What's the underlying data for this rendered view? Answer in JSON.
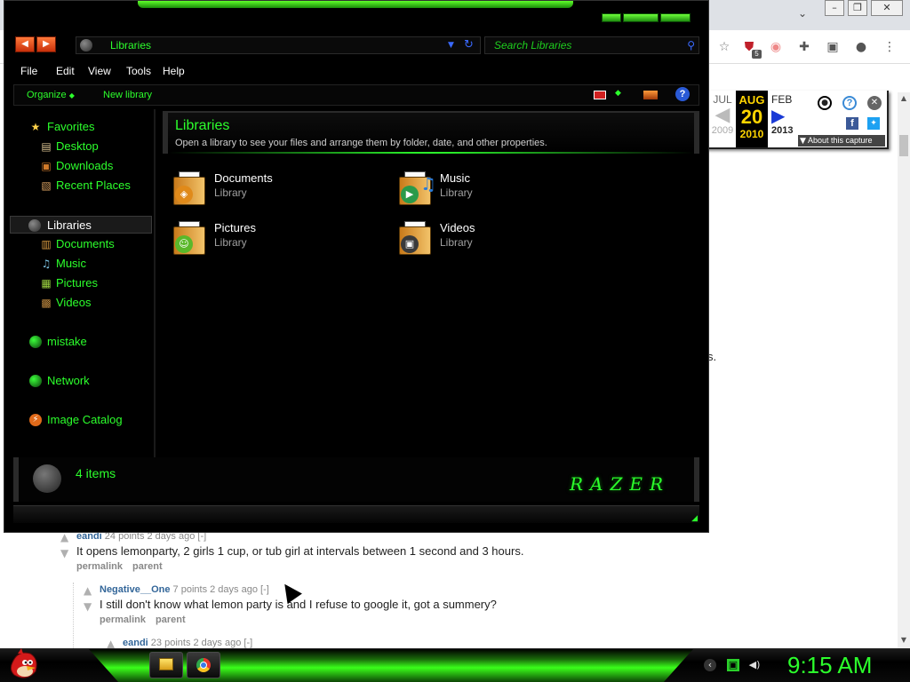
{
  "browser": {
    "tab_overflow_icon": "chevron-down-icon",
    "window_controls": [
      "minimize-icon",
      "restore-icon",
      "close-icon"
    ],
    "extension_badge": "5",
    "page_fragment": "s.",
    "wayback": {
      "prev_month": "JUL",
      "prev_year": "2009",
      "cur_month": "AUG",
      "cur_day": "20",
      "cur_year": "2010",
      "next_month": "FEB",
      "next_year": "2013",
      "about_label": "About this capture"
    }
  },
  "comments": [
    {
      "author": "eandi",
      "meta": "24 points 2 days ago",
      "collapse": "[-]",
      "text": "It opens lemonparty, 2 girls 1 cup, or tub girl at intervals between 1 second and 3 hours.",
      "links": [
        "permalink",
        "parent"
      ]
    },
    {
      "author": "Negative__One",
      "meta": "7 points 2 days ago",
      "collapse": "[-]",
      "text": "I still don't know what lemon party is and I refuse to google it, got a summery?",
      "links": [
        "permalink",
        "parent"
      ]
    },
    {
      "author": "eandi",
      "meta": "23 points 2 days ago",
      "collapse": "[-]"
    }
  ],
  "explorer": {
    "address": "Libraries",
    "search_placeholder": "Search Libraries",
    "menu": [
      "File",
      "Edit",
      "View",
      "Tools",
      "Help"
    ],
    "toolbar": {
      "organize": "Organize",
      "new_library": "New library"
    },
    "nav": {
      "favorites": "Favorites",
      "desktop": "Desktop",
      "downloads": "Downloads",
      "recent_places": "Recent Places",
      "libraries": "Libraries",
      "documents": "Documents",
      "music": "Music",
      "pictures": "Pictures",
      "videos": "Videos",
      "mistake": "mistake",
      "network": "Network",
      "image_catalog": "Image Catalog"
    },
    "header": {
      "title": "Libraries",
      "subtitle": "Open a library to see your files and arrange them by folder, date, and other properties."
    },
    "libraries": [
      {
        "name": "Documents",
        "type": "Library"
      },
      {
        "name": "Music",
        "type": "Library"
      },
      {
        "name": "Pictures",
        "type": "Library"
      },
      {
        "name": "Videos",
        "type": "Library"
      }
    ],
    "details": {
      "count": "4 items",
      "logo": "RAZER"
    },
    "accent": "#2cff2c"
  },
  "taskbar": {
    "clock": "9:15 AM",
    "accent": "#3aff1a"
  }
}
